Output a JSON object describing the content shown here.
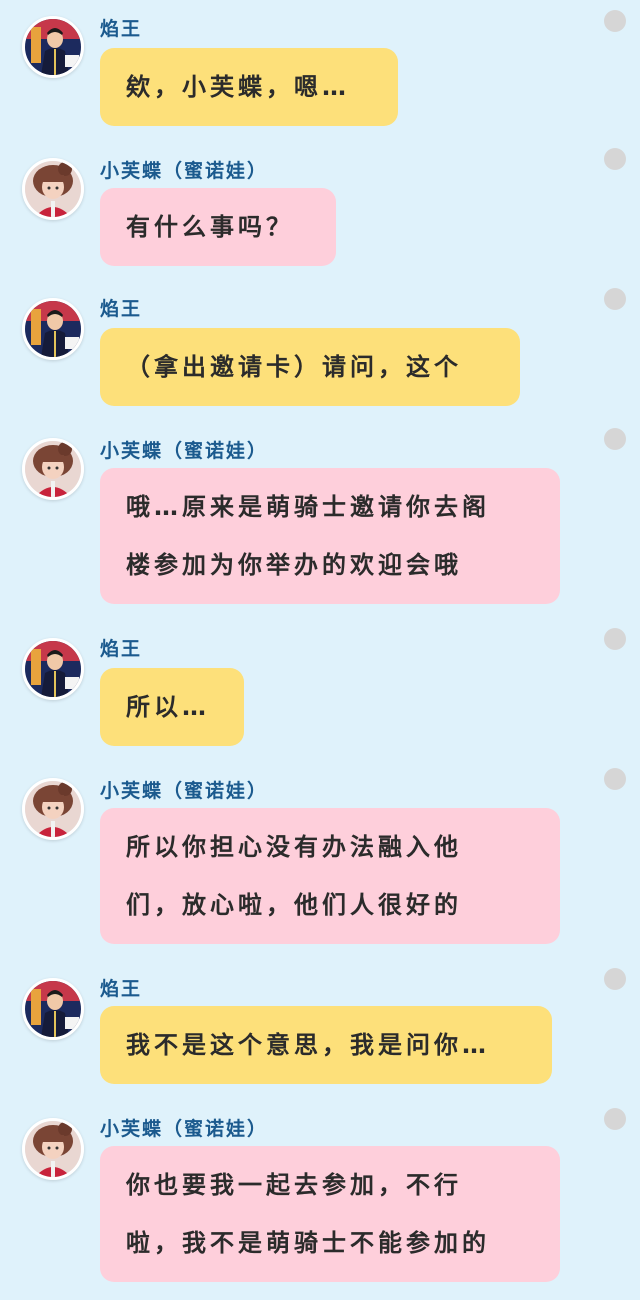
{
  "conversation": {
    "speakers": {
      "yanwang": "焰王",
      "xiaofudie": "小芙蝶（蜜诺娃）"
    },
    "messages": [
      {
        "speaker": "焰王",
        "text": "欸，小芙蝶，嗯…",
        "bubble_color": "#fde07a"
      },
      {
        "speaker": "小芙蝶（蜜诺娃）",
        "text": "有什么事吗？",
        "bubble_color": "#fecfdb"
      },
      {
        "speaker": "焰王",
        "text": "（拿出邀请卡）请问，这个",
        "bubble_color": "#fde07a"
      },
      {
        "speaker": "小芙蝶（蜜诺娃）",
        "text": "哦…原来是萌骑士邀请你去阁\n楼参加为你举办的欢迎会哦",
        "bubble_color": "#fecfdb"
      },
      {
        "speaker": "焰王",
        "text": "所以…",
        "bubble_color": "#fde07a"
      },
      {
        "speaker": "小芙蝶（蜜诺娃）",
        "text": "所以你担心没有办法融入他\n们，放心啦，他们人很好的",
        "bubble_color": "#fecfdb"
      },
      {
        "speaker": "焰王",
        "text": "我不是这个意思，我是问你…",
        "bubble_color": "#fde07a"
      },
      {
        "speaker": "小芙蝶（蜜诺娃）",
        "text": "你也要我一起去参加，不行\n啦，我不是萌骑士不能参加的",
        "bubble_color": "#fecfdb"
      }
    ]
  },
  "colors": {
    "background": "#dff2fb",
    "name_text": "#1b5a8e",
    "yellow_bubble": "#fde07a",
    "pink_bubble": "#fecfdb",
    "side_dot": "#d6d6d6"
  },
  "icons": {
    "avatar_yanwang": "avatar-yanwang-icon",
    "avatar_xiaofudie": "avatar-xiaofudie-icon",
    "side_dot": "circle-dot-icon"
  }
}
